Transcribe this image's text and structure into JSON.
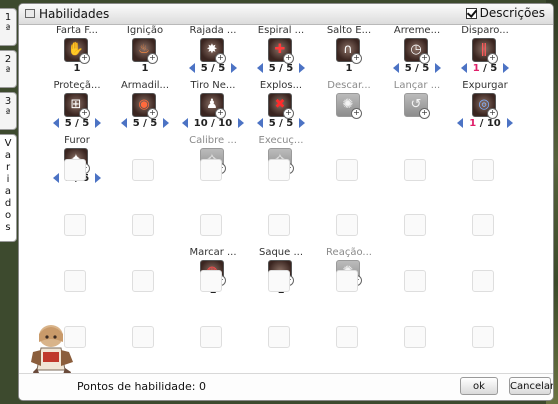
{
  "side_tabs": [
    {
      "label": [
        "1",
        "ª"
      ]
    },
    {
      "label": [
        "2",
        "ª"
      ]
    },
    {
      "label": [
        "3",
        "ª"
      ]
    },
    {
      "label": [
        "V",
        "a",
        "r",
        "i",
        "a",
        "d",
        "o",
        "s"
      ]
    }
  ],
  "window": {
    "title": "Habilidades",
    "descriptions_label": "Descrições",
    "descriptions_checked": true
  },
  "skills": [
    {
      "name": "Farta F...",
      "level": "1",
      "arrows": false,
      "locked": false,
      "icon": "hands-icon"
    },
    {
      "name": "Ignição",
      "level": "1",
      "arrows": false,
      "locked": false,
      "icon": "flame-icon"
    },
    {
      "name": "Rajada ...",
      "level": "5 / 5",
      "arrows": true,
      "locked": false,
      "icon": "burst-icon"
    },
    {
      "name": "Espiral ...",
      "level": "5 / 5",
      "arrows": true,
      "locked": false,
      "icon": "spiral-icon"
    },
    {
      "name": "Salto E...",
      "level": "1",
      "arrows": false,
      "locked": false,
      "icon": "arc-icon"
    },
    {
      "name": "Arreme...",
      "level": "5 / 5",
      "arrows": true,
      "locked": false,
      "icon": "clock-icon"
    },
    {
      "name": "Disparo...",
      "level_cur": "1",
      "level_max": " / 5",
      "arrows": true,
      "locked": false,
      "icon": "rain-icon"
    },
    {
      "name": "Proteçã...",
      "level": "5 / 5",
      "arrows": true,
      "locked": false,
      "icon": "shield-icon"
    },
    {
      "name": "Armadil...",
      "level": "5 / 5",
      "arrows": true,
      "locked": false,
      "icon": "trap-icon"
    },
    {
      "name": "Tiro Ne...",
      "level": "10 / 10",
      "arrows": true,
      "locked": false,
      "icon": "figure-icon"
    },
    {
      "name": "Explos...",
      "level": "5 / 5",
      "arrows": true,
      "locked": false,
      "icon": "explosion-icon"
    },
    {
      "name": "Descar...",
      "level": "",
      "arrows": false,
      "locked": true,
      "icon": "discharge-icon"
    },
    {
      "name": "Lançar ...",
      "level": "",
      "arrows": false,
      "locked": true,
      "icon": "throw-icon"
    },
    {
      "name": "Expurgar",
      "level_cur": "1",
      "level_max": " / 10",
      "arrows": true,
      "locked": false,
      "icon": "target-icon"
    },
    {
      "name": "Furor",
      "level": "5 / 5",
      "arrows": true,
      "locked": false,
      "icon": "fury-icon"
    },
    {
      "name": "Calibre ...",
      "level": "",
      "arrows": false,
      "locked": true,
      "icon": "caliber-icon"
    },
    {
      "name": "Execuç...",
      "level": "",
      "arrows": false,
      "locked": true,
      "icon": "execution-icon"
    },
    {
      "name": "Marcar ...",
      "level": "1",
      "arrows": false,
      "locked": false,
      "icon": "mark-icon"
    },
    {
      "name": "Saque ...",
      "level": "1",
      "arrows": false,
      "locked": false,
      "icon": "quickdraw-icon"
    },
    {
      "name": "Reação...",
      "level": "",
      "arrows": false,
      "locked": true,
      "icon": "reaction-icon"
    }
  ],
  "footer": {
    "points_label": "Pontos de habilidade: 0",
    "ok_label": "ok",
    "cancel_label": "Cancelar"
  }
}
